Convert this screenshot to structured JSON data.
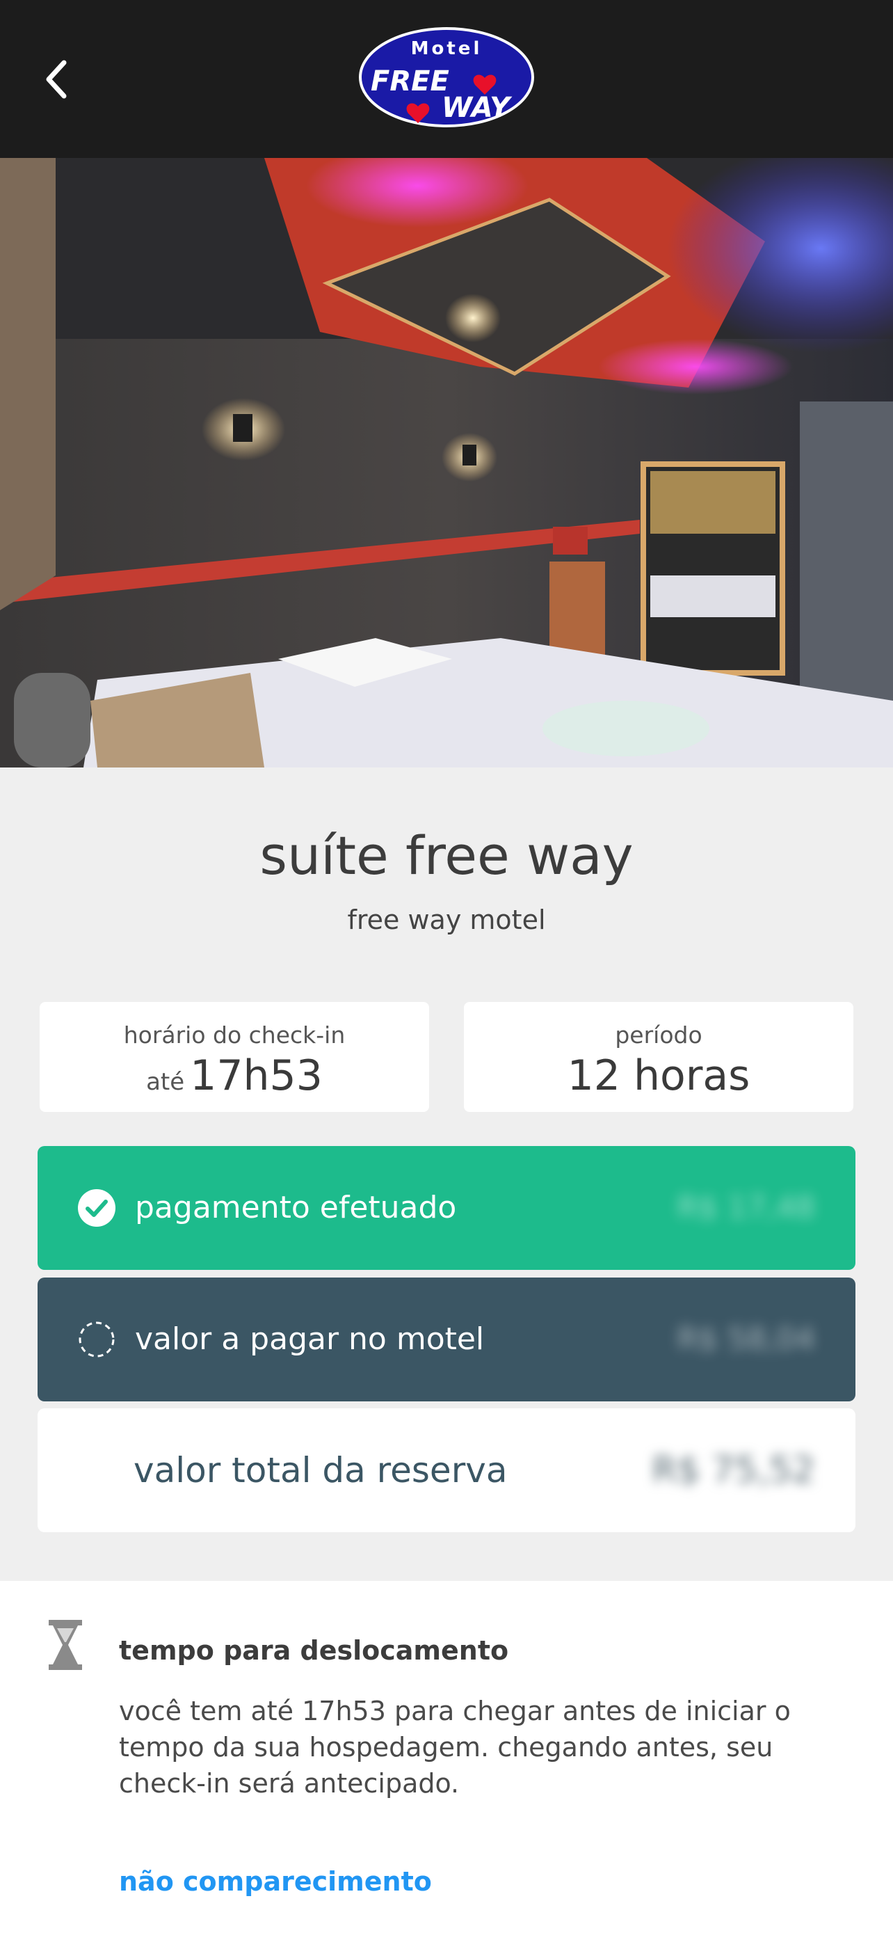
{
  "header": {
    "logo_top": "Motel",
    "logo_mid": "FREE",
    "logo_bottom": "WAY"
  },
  "suite": {
    "title": "suíte free way",
    "motel_name": "free way motel"
  },
  "checkin": {
    "label": "horário do check-in",
    "prefix": "até",
    "value": "17h53"
  },
  "period": {
    "label": "período",
    "value": "12 horas"
  },
  "payment": {
    "paid_label": "pagamento efetuado",
    "paid_amount": "R$ 17,48",
    "due_label": "valor a pagar no motel",
    "due_amount": "R$ 58,04",
    "total_label": "valor total da reserva",
    "total_amount": "R$ 75,52"
  },
  "travel": {
    "title": "tempo para deslocamento",
    "text": "você tem até 17h53 para chegar antes de iniciar o tempo da sua hospedagem. chegando antes, seu check-in será antecipado.",
    "no_show_link": "não comparecimento"
  },
  "colors": {
    "header_bg": "#1c1c1c",
    "paid_bg": "#1dbb8c",
    "due_bg": "#3b5664",
    "link": "#2196f3",
    "logo_blue": "#1a1aa6",
    "heart_red": "#e8102a"
  },
  "icons": {
    "back": "chevron-left-icon",
    "paid": "check-circle-icon",
    "due": "dashed-circle-icon",
    "travel": "hourglass-icon"
  }
}
